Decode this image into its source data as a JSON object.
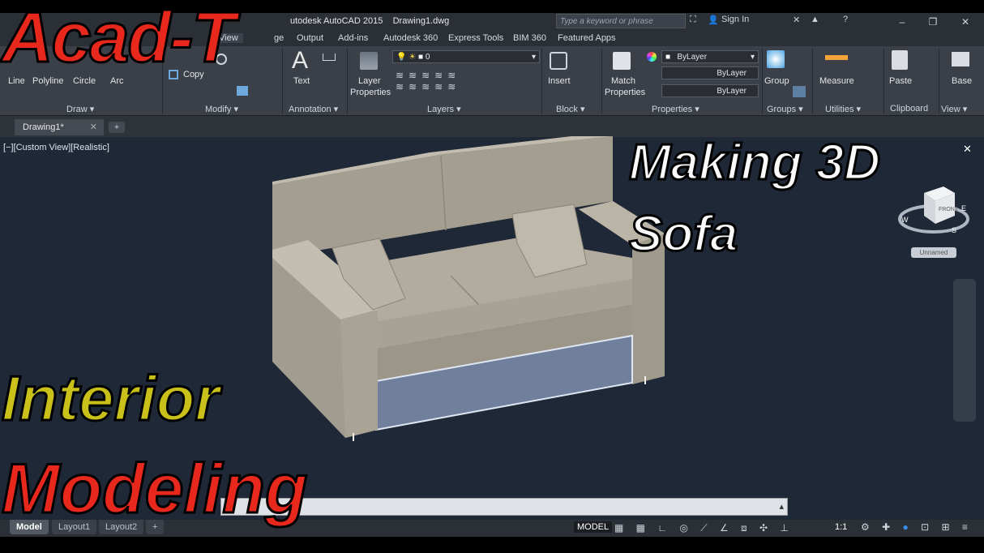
{
  "titlebar": {
    "app_title": "utodesk AutoCAD 2015",
    "filename": "Drawing1.dwg",
    "search_placeholder": "Type a keyword or phrase",
    "sign_in": "Sign In"
  },
  "ribbon_tabs": [
    "View",
    "ge",
    "Output",
    "Add-ins",
    "Autodesk 360",
    "Express Tools",
    "BIM 360",
    "Featured Apps"
  ],
  "draw_panel": {
    "line": "Line",
    "polyline": "Polyline",
    "circle": "Circle",
    "arc": "Arc",
    "label": "Draw"
  },
  "modify_panel": {
    "copy": "Copy",
    "label": "Modify"
  },
  "annotation_panel": {
    "text": "Text",
    "label": "Annotation"
  },
  "layers_panel": {
    "layer_properties_1": "Layer",
    "layer_properties_2": "Properties",
    "current_layer": "0",
    "label": "Layers"
  },
  "block_panel": {
    "insert": "Insert",
    "label": "Block"
  },
  "properties_panel": {
    "match_1": "Match",
    "match_2": "Properties",
    "color": "ByLayer",
    "linetype": "ByLayer",
    "lineweight": "ByLayer",
    "label": "Properties"
  },
  "groups_panel": {
    "group": "Group",
    "label": "Groups"
  },
  "utilities_panel": {
    "measure": "Measure",
    "label": "Utilities"
  },
  "clipboard_panel": {
    "paste": "Paste",
    "label": "Clipboard"
  },
  "view_panel": {
    "base": "Base",
    "label": "View"
  },
  "document": {
    "tab": "Drawing1*"
  },
  "viewport": {
    "label": "[−][Custom View][Realistic]"
  },
  "viewcube": {
    "face": "FRONT",
    "west": "W",
    "south": "S",
    "east": "E",
    "ucs": "Unnamed"
  },
  "layout_tabs": [
    "Model",
    "Layout1",
    "Layout2"
  ],
  "status": {
    "model": "MODEL",
    "scale": "1:1"
  },
  "overlay": {
    "brand": "Acad-T",
    "title_line1": "Making 3D",
    "title_line2": "Sofa",
    "subtitle_line1": "Interior",
    "subtitle_line2": "Modeling"
  },
  "colors": {
    "accent_red": "#e8271d",
    "accent_yellow": "#c9c11a",
    "viewport_bg": "#1f2836",
    "sofa": "#9f998b"
  }
}
